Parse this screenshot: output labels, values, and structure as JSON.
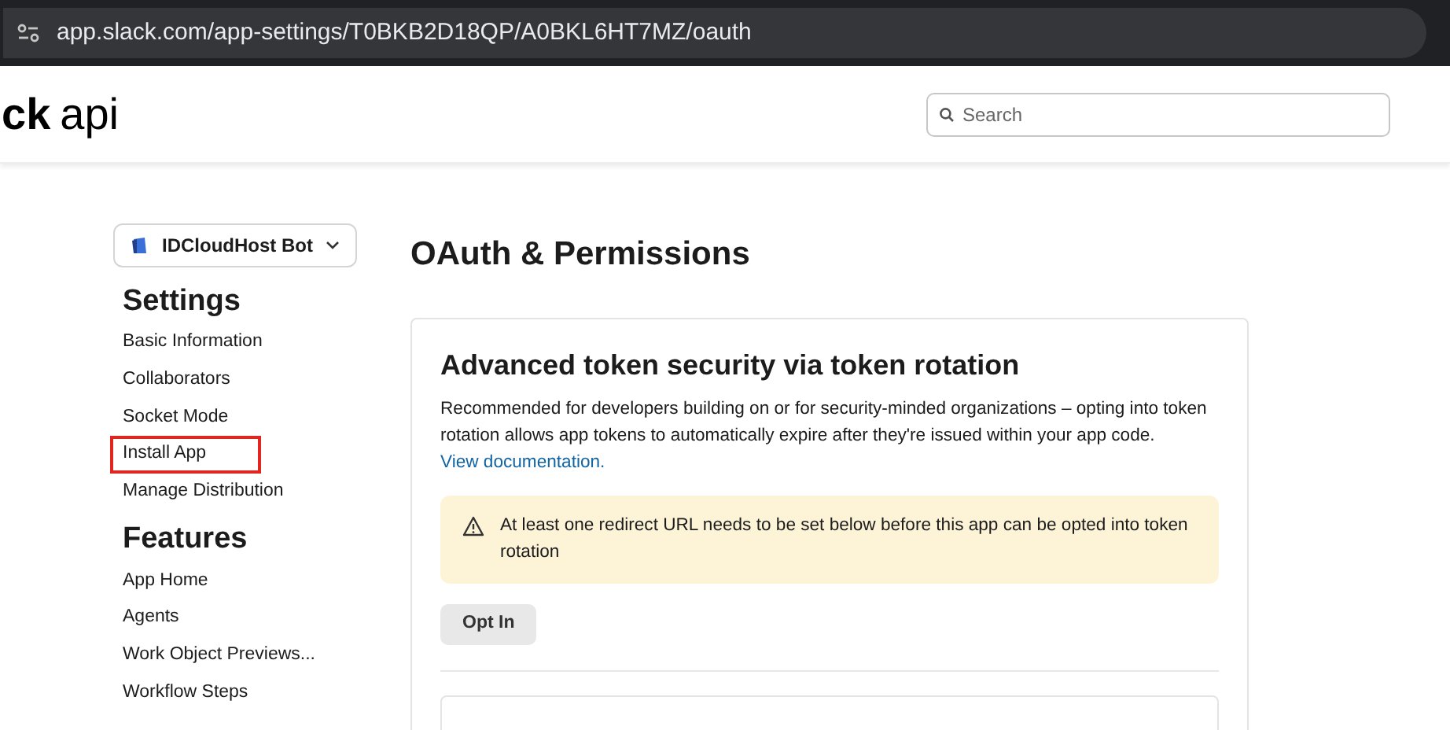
{
  "address_bar": {
    "url": "app.slack.com/app-settings/T0BKB2D18QP/A0BKL6HT7MZ/oauth"
  },
  "header": {
    "logo_bold": "ck",
    "logo_light": "api",
    "search": {
      "placeholder": "Search"
    }
  },
  "app_selector": {
    "label": "IDCloudHost Bot"
  },
  "sidebar": [
    {
      "heading": "Settings",
      "items": [
        {
          "label": "Basic Information",
          "highlighted": false
        },
        {
          "label": "Collaborators",
          "highlighted": false
        },
        {
          "label": "Socket Mode",
          "highlighted": false
        },
        {
          "label": "Install App",
          "highlighted": true
        },
        {
          "label": "Manage Distribution",
          "highlighted": false
        }
      ]
    },
    {
      "heading": "Features",
      "items": [
        {
          "label": "App Home",
          "highlighted": false
        },
        {
          "label": "Agents",
          "highlighted": false
        },
        {
          "label": "Work Object Previews...",
          "highlighted": false
        },
        {
          "label": "Workflow Steps",
          "highlighted": false
        }
      ]
    }
  ],
  "page_title": "OAuth & Permissions",
  "card": {
    "title": "Advanced token security via token rotation",
    "body": "Recommended for developers building on or for security-minded organizations – opting into token rotation allows app tokens to automatically expire after they're issued within your app code.",
    "link": "View documentation.",
    "warning": "At least one redirect URL needs to be set below before this app can be opted into token rotation",
    "button": "Opt In"
  }
}
